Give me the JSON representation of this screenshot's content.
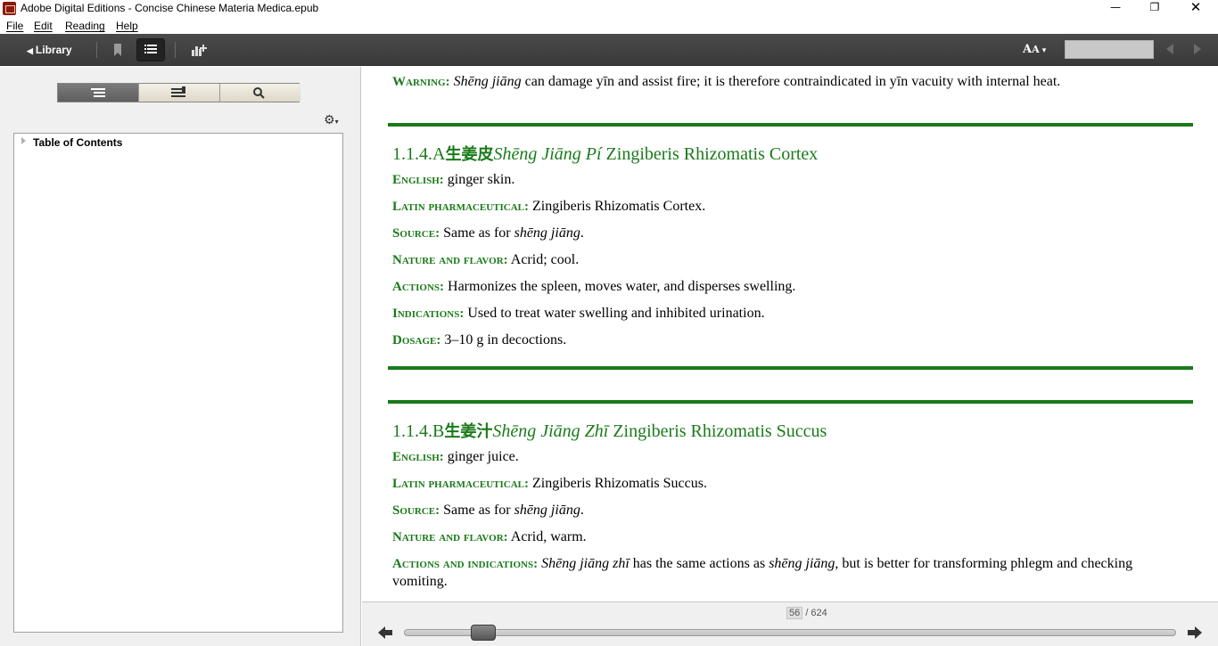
{
  "window": {
    "title": "Adobe Digital Editions - Concise Chinese Materia Medica.epub",
    "min_glyph": "—",
    "max_glyph": "❐",
    "close_glyph": "✕"
  },
  "menu": {
    "items": [
      "File",
      "Edit",
      "Reading",
      "Help"
    ]
  },
  "toolbar": {
    "library_label": "Library",
    "font_size_big": "A",
    "font_size_small": "A",
    "search_value": ""
  },
  "left_panel": {
    "toc_root_label": "Table of Contents"
  },
  "content": {
    "warning": {
      "label": "Warning:",
      "pinyin": "Shēng jiāng",
      "text": " can damage yīn and assist fire; it is therefore contraindicated in yīn vacuity with internal heat."
    },
    "sections": [
      {
        "num": "1.1.4.A",
        "cn": "生姜皮",
        "pinyin": "Shēng Jiāng Pí",
        "latin": " Zingiberis Rhizomatis Cortex",
        "fields": [
          {
            "label": "English:",
            "value": " ginger skin."
          },
          {
            "label": "Latin pharmaceutical:",
            "value": " Zingiberis Rhizomatis Cortex."
          },
          {
            "label": "Source:",
            "value_pre": " Same as for ",
            "value_it": "shēng jiāng",
            "value_post": "."
          },
          {
            "label": "Nature and flavor:",
            "value": " Acrid; cool."
          },
          {
            "label": "Actions:",
            "value": " Harmonizes the spleen, moves water, and disperses swelling."
          },
          {
            "label": "Indications:",
            "value": " Used to treat water swelling and inhibited urination."
          },
          {
            "label": "Dosage:",
            "value": " 3–10 g in decoctions."
          }
        ]
      },
      {
        "num": "1.1.4.B",
        "cn": "生姜汁",
        "pinyin": "Shēng Jiāng Zhī",
        "latin": " Zingiberis Rhizomatis Succus",
        "fields": [
          {
            "label": "English:",
            "value": " ginger juice."
          },
          {
            "label": "Latin pharmaceutical:",
            "value": " Zingiberis Rhizomatis Succus."
          },
          {
            "label": "Source:",
            "value_pre": " Same as for ",
            "value_it": "shēng jiāng",
            "value_post": "."
          },
          {
            "label": "Nature and flavor:",
            "value": " Acrid, warm."
          },
          {
            "label": "Actions and indications:",
            "value_it1": "Shēng jiāng zhī",
            "value_mid": " has the same actions as ",
            "value_it2": "shēng jiāng",
            "value_post": ", but is better for transforming phlegm and checking",
            "value_line2": "vomiting."
          }
        ]
      }
    ]
  },
  "pager": {
    "current_page": "56",
    "total_pages": "/ 624",
    "progress_fraction": 0.0897
  },
  "colors": {
    "accent_green": "#1a7a1a",
    "toolbar_dark": "#3a3a3a"
  },
  "icons": {
    "app": "adobe-digital-editions-icon",
    "bookmark": "bookmark-icon",
    "toc": "list-icon",
    "stats": "bar-chart-plus-icon",
    "settings": "gear-icon",
    "search": "magnifier-icon",
    "prev": "arrow-left-icon",
    "next": "arrow-right-icon"
  }
}
